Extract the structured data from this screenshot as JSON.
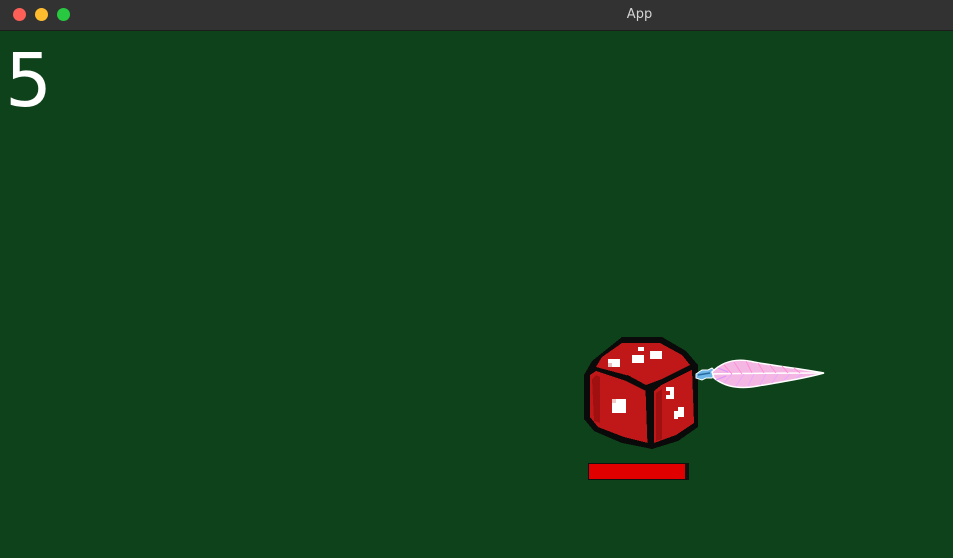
{
  "window": {
    "title": "App",
    "controls": {
      "close_color": "#fe5f57",
      "minimize_color": "#febc2e",
      "maximize_color": "#28c840"
    }
  },
  "game": {
    "score": "5",
    "background_color": "#0e421a",
    "enemy": {
      "type": "red-die",
      "icon": "dice-icon",
      "body_color": "#c01818",
      "health_fraction": 0.97,
      "health_color": "#e00000"
    },
    "projectile": {
      "type": "feather",
      "icon": "feather-icon",
      "color": "#f4b6e2"
    }
  }
}
